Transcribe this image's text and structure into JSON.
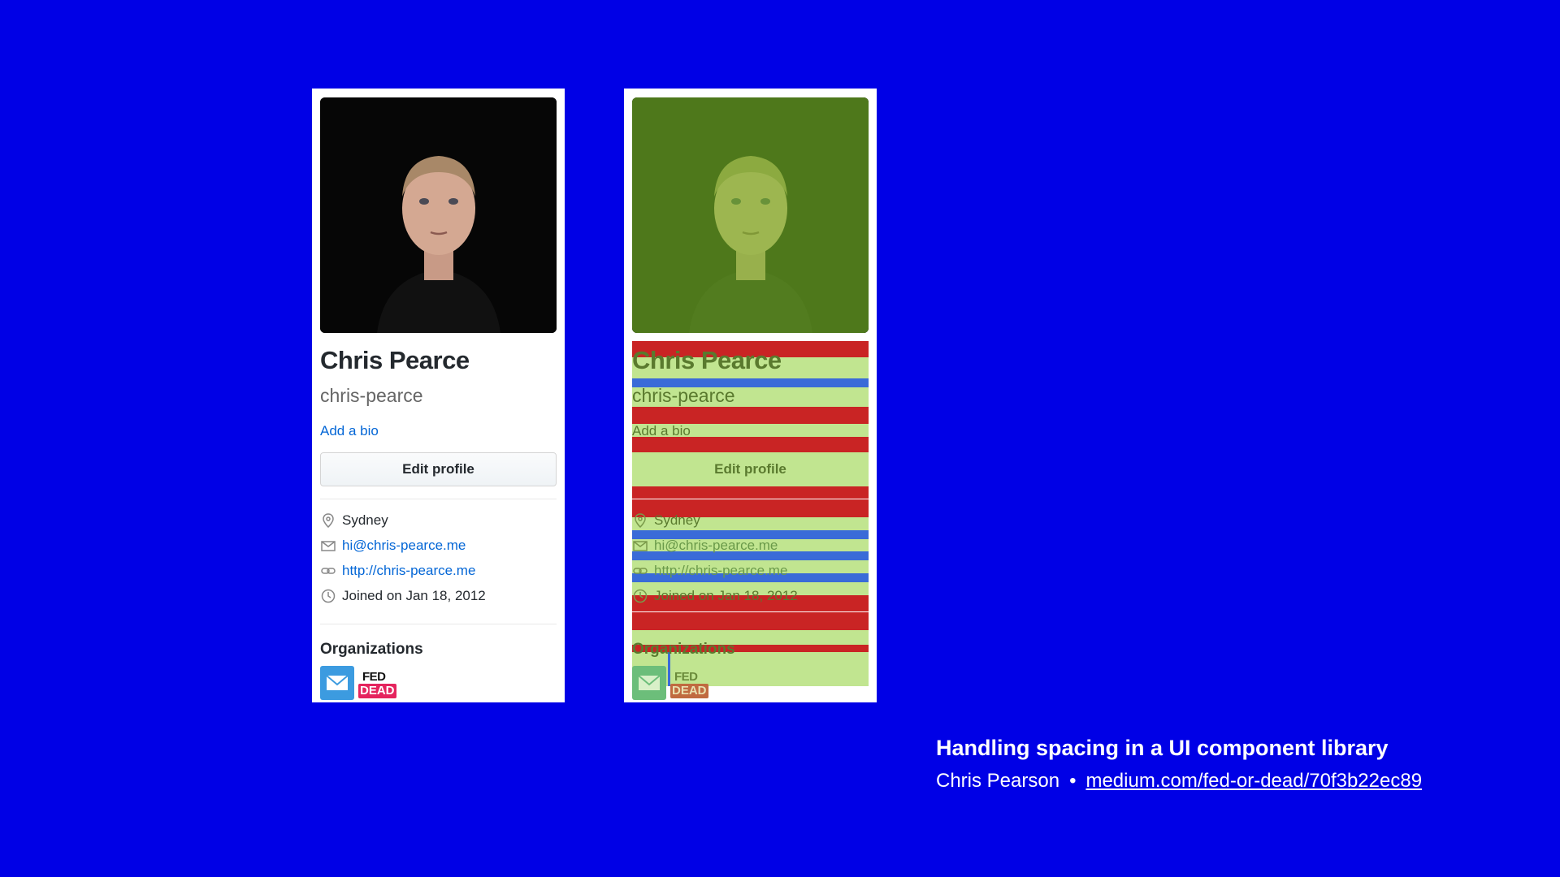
{
  "profile": {
    "name": "Chris Pearce",
    "login": "chris-pearce",
    "bio_link": "Add a bio",
    "edit_button": "Edit profile",
    "details": {
      "location": "Sydney",
      "email": "hi@chris-pearce.me",
      "website": "http://chris-pearce.me",
      "joined": "Joined on Jan 18, 2012"
    },
    "organizations_title": "Organizations",
    "org_badge": {
      "line1": "FED",
      "line2": "DEAD"
    }
  },
  "colors": {
    "background": "#0000e6",
    "link": "#0366d6",
    "overlay_margin": "#c92424",
    "overlay_gap": "#3a6bd8",
    "overlay_content": "#c1e590"
  },
  "caption": {
    "title": "Handling spacing in a UI component library",
    "author": "Chris Pearson",
    "separator": "•",
    "url": "medium.com/fed-or-dead/70f3b22ec89"
  }
}
